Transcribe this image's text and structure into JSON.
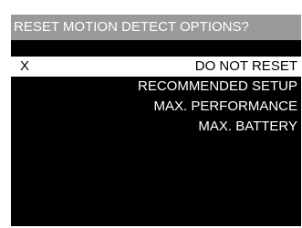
{
  "dialog": {
    "title": "RESET MOTION DETECT OPTIONS?",
    "selected_marker": "X",
    "options": [
      {
        "label": "DO NOT RESET",
        "selected": true
      },
      {
        "label": "RECOMMENDED SETUP",
        "selected": false
      },
      {
        "label": "MAX. PERFORMANCE",
        "selected": false
      },
      {
        "label": "MAX. BATTERY",
        "selected": false
      }
    ]
  },
  "colors": {
    "background": "#000000",
    "title_bar": "#9a9a9a",
    "text": "#ffffff",
    "selected_background": "#ffffff",
    "selected_text": "#000000"
  }
}
